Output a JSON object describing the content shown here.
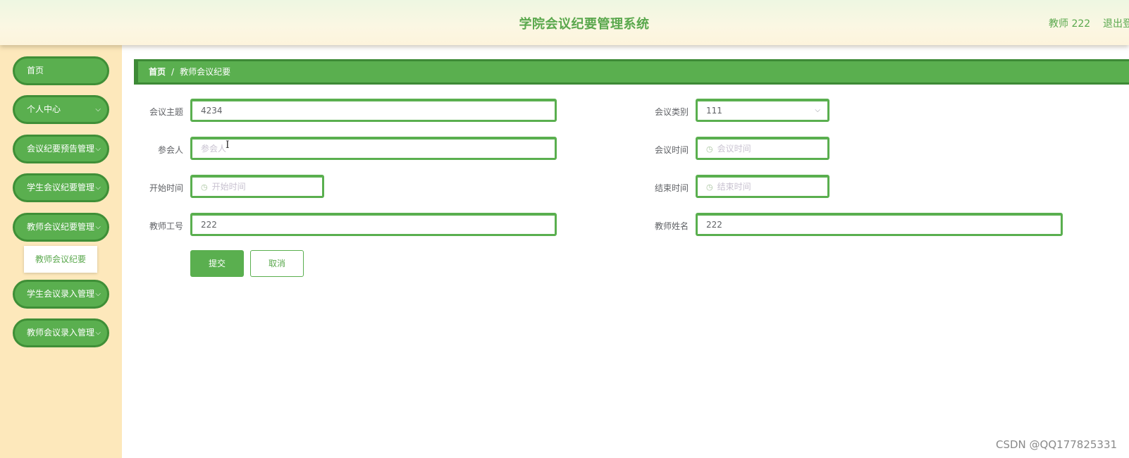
{
  "header": {
    "title": "学院会议纪要管理系统",
    "user": "教师 222",
    "logout": "退出登"
  },
  "sidebar": {
    "items": [
      {
        "label": "首页",
        "has_chevron": false
      },
      {
        "label": "个人中心",
        "has_chevron": true
      },
      {
        "label": "会议纪要预告管理",
        "has_chevron": true
      },
      {
        "label": "学生会议纪要管理",
        "has_chevron": true
      },
      {
        "label": "教师会议纪要管理",
        "has_chevron": true
      },
      {
        "label": "学生会议录入管理",
        "has_chevron": true
      },
      {
        "label": "教师会议录入管理",
        "has_chevron": true
      }
    ],
    "submenu_item": "教师会议纪要",
    "chevron_icon": "chevron-down-icon"
  },
  "breadcrumb": {
    "home": "首页",
    "separator": "/",
    "current": "教师会议纪要"
  },
  "form": {
    "topic": {
      "label": "会议主题",
      "value": "4234"
    },
    "category": {
      "label": "会议类别",
      "value": "111"
    },
    "attendees": {
      "label": "参会人",
      "placeholder": "参会人"
    },
    "meeting_time": {
      "label": "会议时间",
      "placeholder": "会议时间"
    },
    "start_time": {
      "label": "开始时间",
      "placeholder": "开始时间"
    },
    "end_time": {
      "label": "结束时间",
      "placeholder": "结束时间"
    },
    "teacher_id": {
      "label": "教师工号",
      "value": "222"
    },
    "teacher_name": {
      "label": "教师姓名",
      "value": "222"
    },
    "submit": "提交",
    "cancel": "取消"
  },
  "watermark": "CSDN @QQ177825331",
  "colors": {
    "accent": "#5aaf4f",
    "accent_dark": "#3d8a36",
    "sidebar_bg": "#fde8bb",
    "title_text": "#5aa84d"
  }
}
